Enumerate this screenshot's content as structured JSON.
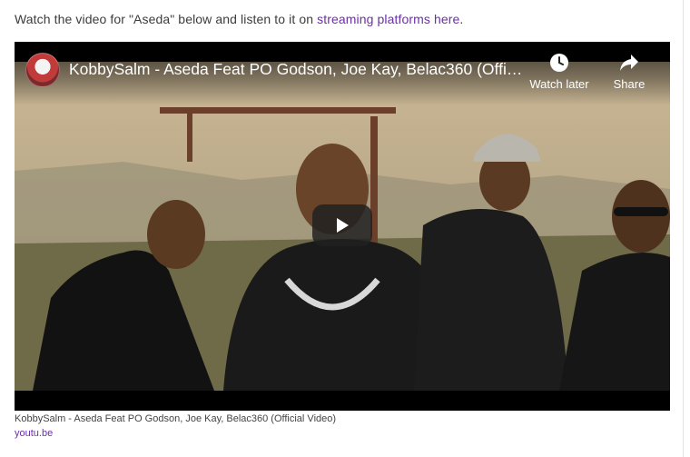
{
  "intro": {
    "prefix": "Watch the video for \"Aseda\" below and listen to it on ",
    "link_text": "streaming platforms here",
    "suffix": "."
  },
  "video": {
    "title": "KobbySalm - Aseda Feat PO Godson, Joe Kay, Belac360 (Offici...",
    "actions": {
      "watch_later": "Watch later",
      "share": "Share"
    }
  },
  "caption": "KobbySalm - Aseda Feat PO Godson, Joe Kay, Belac360 (Official Video)",
  "source": "youtu.be",
  "colors": {
    "link": "#6b2fa6",
    "text": "#3c3c3c"
  }
}
